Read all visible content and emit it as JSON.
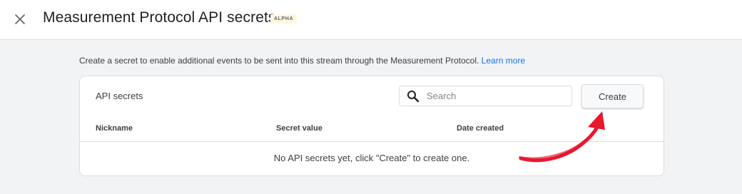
{
  "header": {
    "title": "Measurement Protocol API secrets",
    "badge": "ALPHA"
  },
  "intro": {
    "text": "Create a secret to enable additional events to be sent into this stream through the Measurement Protocol.",
    "link": "Learn more"
  },
  "card": {
    "title": "API secrets",
    "search_placeholder": "Search",
    "search_value": "",
    "create_label": "Create",
    "columns": [
      "Nickname",
      "Secret value",
      "Date created"
    ],
    "empty_message": "No API secrets yet, click \"Create\" to create one."
  },
  "colors": {
    "accent": "#1a73e8",
    "background": "#f1f3f4",
    "annotation_arrow": "#e8182c"
  },
  "icons": [
    "close-icon",
    "search-icon",
    "annotation-arrow"
  ]
}
